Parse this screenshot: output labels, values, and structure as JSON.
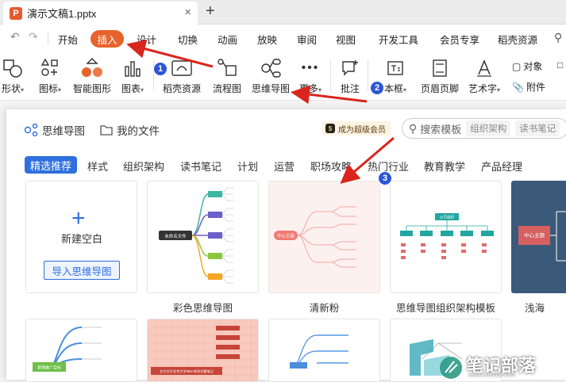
{
  "window": {
    "doc_name": "演示文稿1.pptx",
    "ppt_badge": "P",
    "close": "×",
    "new_tab": "+"
  },
  "menu": {
    "undo": "↶",
    "redo": "↷",
    "items": [
      "开始",
      "插入",
      "设计",
      "切换",
      "动画",
      "放映",
      "审阅",
      "视图",
      "开发工具",
      "会员专享",
      "稻壳资源"
    ],
    "active_index": 1
  },
  "ribbon": {
    "items": [
      "形状",
      "图标",
      "智能图形",
      "图表",
      "稻壳资源",
      "流程图",
      "思维导图",
      "更多",
      "批注",
      "本框",
      "页眉页脚",
      "艺术字",
      "对象",
      "附件"
    ],
    "arrow": "▾"
  },
  "panel": {
    "tab_mindmap": "思维导图",
    "tab_myfiles": "我的文件",
    "vip_label": "成为超级会员",
    "vip_coin": "$",
    "search_placeholder": "搜索模板",
    "search_chips": [
      "组织架构",
      "读书笔记"
    ],
    "categories": [
      "精选推荐",
      "样式",
      "组织架构",
      "读书笔记",
      "计划",
      "运营",
      "职场攻略",
      "热门行业",
      "教育教学",
      "产品经理"
    ],
    "active_category": 0,
    "new_blank": "新建空白",
    "new_plus": "+",
    "import_btn": "导入思维导图",
    "templates": [
      {
        "name": "彩色思维导图"
      },
      {
        "name": "清新粉"
      },
      {
        "name": "思维导图组织架构模板"
      },
      {
        "name": "浅海"
      }
    ],
    "thumb_text": {
      "colorful_root": "未命名文件",
      "pink_root": "中心主题",
      "org_root": "公司组织",
      "dark_root": "中心主题",
      "row2_green": "营销推广目标",
      "row2_red": "北大光华北京大学MBA考研学霸笔记"
    }
  },
  "annotations": {
    "badges": [
      "1",
      "2",
      "3"
    ]
  },
  "watermark": {
    "text": "笔记部落",
    "url": "www.notetribe.com"
  },
  "colors": {
    "accent": "#e8622c",
    "brand_blue": "#2f6fde",
    "badge": "#2c55d6",
    "arrow_red": "#d9261c"
  }
}
